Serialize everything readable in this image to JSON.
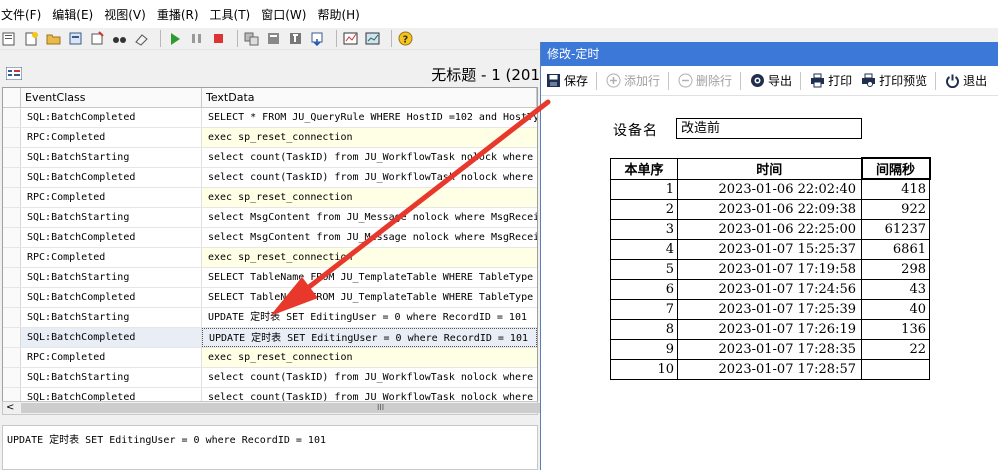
{
  "menu": [
    "文件(F)",
    "编辑(E)",
    "视图(V)",
    "重播(R)",
    "工具(T)",
    "窗口(W)",
    "帮助(H)"
  ],
  "profiler": {
    "title": "无标题 - 1 (201",
    "columns": {
      "event_class": "EventClass",
      "text_data": "TextData"
    },
    "rows": [
      {
        "event": "SQL:BatchCompleted",
        "text": "SELECT * FROM JU_QueryRule WHERE HostID =102 and HostTy",
        "type": "sql"
      },
      {
        "event": "RPC:Completed",
        "text": "exec sp_reset_connection",
        "type": "rpc"
      },
      {
        "event": "SQL:BatchStarting",
        "text": "select count(TaskID) from JU_WorkflowTask nolock where",
        "type": "sql"
      },
      {
        "event": "SQL:BatchCompleted",
        "text": "select count(TaskID) from JU_WorkflowTask nolock where",
        "type": "sql"
      },
      {
        "event": "RPC:Completed",
        "text": "exec sp_reset_connection",
        "type": "rpc"
      },
      {
        "event": "SQL:BatchStarting",
        "text": "select MsgContent from JU_Message nolock where MsgRecei",
        "type": "sql"
      },
      {
        "event": "SQL:BatchCompleted",
        "text": "select MsgContent from JU_Message nolock where MsgRecei",
        "type": "sql"
      },
      {
        "event": "RPC:Completed",
        "text": "exec sp_reset_connection",
        "type": "rpc"
      },
      {
        "event": "SQL:BatchStarting",
        "text": "SELECT TableName FROM JU_TemplateTable WHERE TableType",
        "type": "sql"
      },
      {
        "event": "SQL:BatchCompleted",
        "text": "SELECT TableName FROM JU_TemplateTable WHERE TableType",
        "type": "sql"
      },
      {
        "event": "SQL:BatchStarting",
        "text": "UPDATE 定时表 SET EditingUser = 0 where RecordID = 101",
        "type": "sql"
      },
      {
        "event": "SQL:BatchCompleted",
        "text": "UPDATE 定时表 SET EditingUser = 0 where RecordID = 101",
        "type": "active"
      },
      {
        "event": "RPC:Completed",
        "text": "exec sp_reset_connection",
        "type": "rpc"
      },
      {
        "event": "SQL:BatchStarting",
        "text": "select count(TaskID) from JU_WorkflowTask nolock where",
        "type": "sql"
      },
      {
        "event": "SQL:BatchCompleted",
        "text": "select count(TaskID) from JU_WorkflowTask nolock where",
        "type": "sql"
      }
    ],
    "detail_text": "UPDATE 定时表 SET EditingUser = 0 where RecordID = 101",
    "scroll_grip": "III"
  },
  "dialog": {
    "title": "修改-定时",
    "toolbar": {
      "save": "保存",
      "add_row": "添加行",
      "delete_row": "删除行",
      "export": "导出",
      "print": "打印",
      "print_preview": "打印预览",
      "exit": "退出"
    },
    "device_label": "设备名",
    "device_value": "改造前",
    "table": {
      "headers": [
        "本单序",
        "时间",
        "间隔秒"
      ],
      "rows": [
        {
          "idx": "1",
          "time": "2023-01-06 22:02:40",
          "interval": "418"
        },
        {
          "idx": "2",
          "time": "2023-01-06 22:09:38",
          "interval": "922"
        },
        {
          "idx": "3",
          "time": "2023-01-06 22:25:00",
          "interval": "61237"
        },
        {
          "idx": "4",
          "time": "2023-01-07 15:25:37",
          "interval": "6861"
        },
        {
          "idx": "5",
          "time": "2023-01-07 17:19:58",
          "interval": "298"
        },
        {
          "idx": "6",
          "time": "2023-01-07 17:24:56",
          "interval": "43"
        },
        {
          "idx": "7",
          "time": "2023-01-07 17:25:39",
          "interval": "40"
        },
        {
          "idx": "8",
          "time": "2023-01-07 17:26:19",
          "interval": "136"
        },
        {
          "idx": "9",
          "time": "2023-01-07 17:28:35",
          "interval": "22"
        },
        {
          "idx": "10",
          "time": "2023-01-07 17:28:57",
          "interval": ""
        }
      ]
    }
  },
  "colors": {
    "dialog_title": "#3c78d8",
    "arrow": "#e8372b",
    "rpc_row": "#ffffe6"
  }
}
